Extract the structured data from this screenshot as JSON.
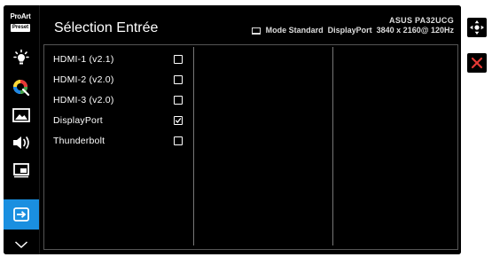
{
  "brand": {
    "line1": "ProArt",
    "line2": "Preset"
  },
  "title": "Sélection Entrée",
  "status": {
    "model": "ASUS PA32UCG",
    "mode": "Mode Standard",
    "input": "DisplayPort",
    "resolution": "3840 x 2160@ 120Hz"
  },
  "sidebar": {
    "items": [
      {
        "icon": "brightness-icon"
      },
      {
        "icon": "color-icon"
      },
      {
        "icon": "image-icon"
      },
      {
        "icon": "sound-icon"
      },
      {
        "icon": "pip-icon"
      },
      {
        "icon": "input-select-icon",
        "active": true
      },
      {
        "icon": "chevron-down-icon"
      }
    ]
  },
  "inputs": [
    {
      "label": "HDMI-1 (v2.1)",
      "checked": false
    },
    {
      "label": "HDMI-2 (v2.0)",
      "checked": false
    },
    {
      "label": "HDMI-3 (v2.0)",
      "checked": false
    },
    {
      "label": "DisplayPort",
      "checked": true
    },
    {
      "label": "Thunderbolt",
      "checked": false
    }
  ],
  "colors": {
    "accent": "#1a8fe0",
    "close": "#e53935",
    "background": "#000000",
    "text": "#ffffff"
  },
  "controls": [
    {
      "icon": "joystick-icon"
    },
    {
      "icon": "close-icon"
    }
  ]
}
